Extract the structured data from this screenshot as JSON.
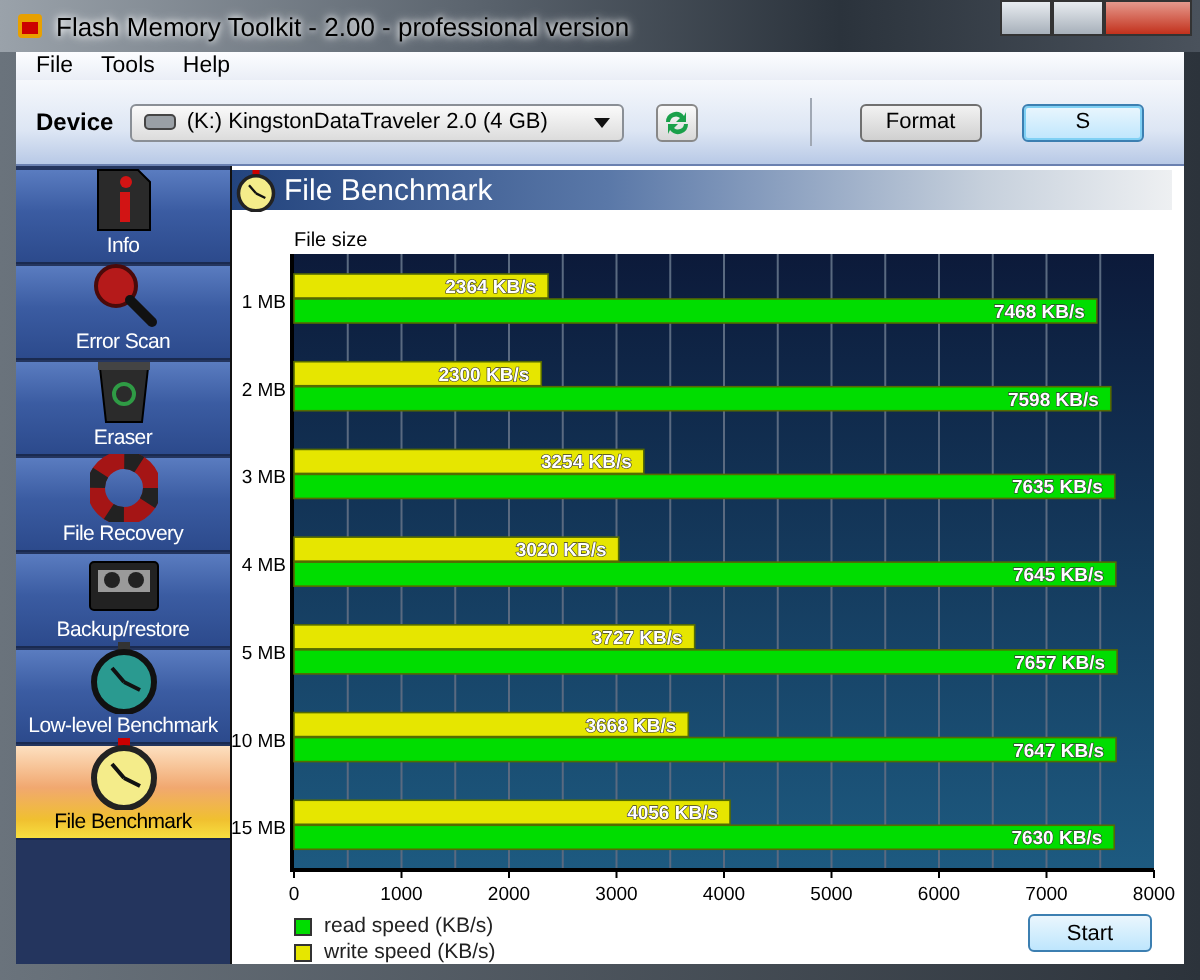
{
  "window": {
    "title": "Flash Memory Toolkit - 2.00 - professional version"
  },
  "menu": [
    "File",
    "Tools",
    "Help"
  ],
  "toolbar": {
    "device_label": "Device",
    "device": "(K:) KingstonDataTraveler 2.0 (4 GB)",
    "buttons": [
      {
        "label": "Format",
        "default": false
      },
      {
        "label": "S",
        "default": true
      }
    ]
  },
  "sidebar": {
    "items": [
      {
        "label": "Info",
        "kind": "info",
        "selected": false
      },
      {
        "label": "Error Scan",
        "kind": "scan",
        "selected": false
      },
      {
        "label": "Eraser",
        "kind": "eraser",
        "selected": false
      },
      {
        "label": "File Recovery",
        "kind": "recovery",
        "selected": false
      },
      {
        "label": "Backup/restore",
        "kind": "backup",
        "selected": false
      },
      {
        "label": "Low-level Benchmark",
        "kind": "lowbench",
        "selected": false
      },
      {
        "label": "File Benchmark",
        "kind": "filebench",
        "selected": true
      }
    ]
  },
  "panel": {
    "title": "File Benchmark",
    "start_button": "Start",
    "chart_data": {
      "type": "bar",
      "orientation": "horizontal",
      "ylabel": "File size",
      "categories": [
        "1 MB",
        "2 MB",
        "3 MB",
        "4 MB",
        "5 MB",
        "10 MB",
        "15 MB"
      ],
      "series": [
        {
          "name": "read speed (KB/s)",
          "color": "#00dd00",
          "values": [
            7468,
            7598,
            7635,
            7645,
            7657,
            7647,
            7630
          ],
          "value_labels": [
            "7468 KB/s",
            "7598 KB/s",
            "7635 KB/s",
            "7645 KB/s",
            "7657 KB/s",
            "7647 KB/s",
            "7630 KB/s"
          ]
        },
        {
          "name": "write speed (KB/s)",
          "color": "#e6e600",
          "values": [
            2364,
            2300,
            3254,
            3020,
            3727,
            3668,
            4056
          ],
          "value_labels": [
            "2364 KB/s",
            "2300 KB/s",
            "3254 KB/s",
            "3020 KB/s",
            "3727 KB/s",
            "3668 KB/s",
            "4056 KB/s"
          ]
        }
      ],
      "grid": true,
      "xlim": [
        0,
        8000
      ],
      "xticks": [
        0,
        1000,
        2000,
        3000,
        4000,
        5000,
        6000,
        7000,
        8000
      ]
    }
  }
}
